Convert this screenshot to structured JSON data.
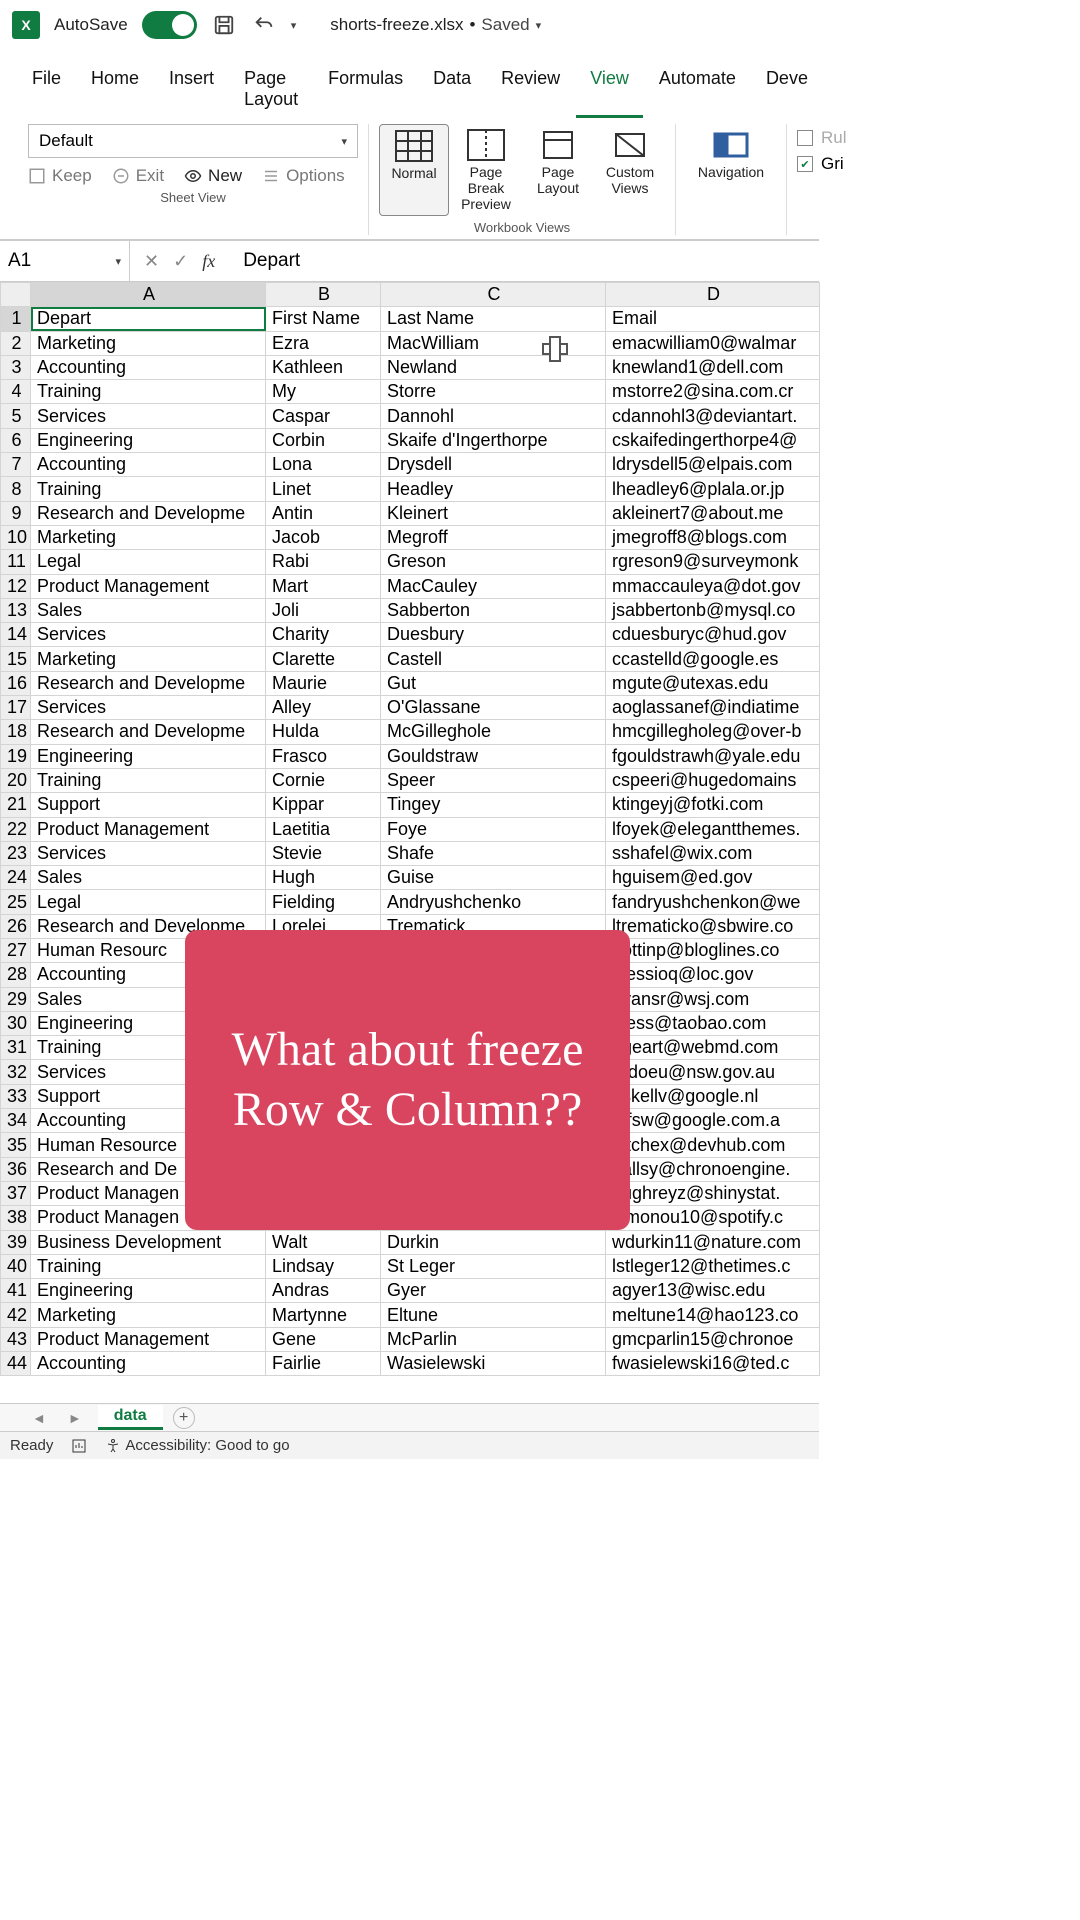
{
  "titlebar": {
    "autosave": "AutoSave",
    "filename": "shorts-freeze.xlsx",
    "state": "Saved"
  },
  "tabs": [
    "File",
    "Home",
    "Insert",
    "Page Layout",
    "Formulas",
    "Data",
    "Review",
    "View",
    "Automate",
    "Deve"
  ],
  "active_tab_index": 7,
  "ribbon": {
    "sheetview": {
      "selector": "Default",
      "keep": "Keep",
      "exit": "Exit",
      "new": "New",
      "options": "Options",
      "group_label": "Sheet View"
    },
    "views": {
      "normal": "Normal",
      "pagebreak": "Page Break Preview",
      "pagelayout": "Page Layout",
      "custom": "Custom Views",
      "group_label": "Workbook Views"
    },
    "nav": {
      "label": "Navigation"
    },
    "show": {
      "rulers": "Rul",
      "gridlines": "Gri"
    }
  },
  "formula_bar": {
    "name": "A1",
    "value": "Depart"
  },
  "columns": [
    "A",
    "B",
    "C",
    "D"
  ],
  "headers": {
    "A": "Depart",
    "B": "First Name",
    "C": "Last Name",
    "D": "Email"
  },
  "rows": [
    {
      "n": 2,
      "A": "Marketing",
      "B": "Ezra",
      "C": "MacWilliam",
      "D": "emacwilliam0@walmar"
    },
    {
      "n": 3,
      "A": "Accounting",
      "B": "Kathleen",
      "C": "Newland",
      "D": "knewland1@dell.com"
    },
    {
      "n": 4,
      "A": "Training",
      "B": "My",
      "C": "Storre",
      "D": "mstorre2@sina.com.cr"
    },
    {
      "n": 5,
      "A": "Services",
      "B": "Caspar",
      "C": "Dannohl",
      "D": "cdannohl3@deviantart."
    },
    {
      "n": 6,
      "A": "Engineering",
      "B": "Corbin",
      "C": "Skaife d'Ingerthorpe",
      "D": "cskaifedingerthorpe4@"
    },
    {
      "n": 7,
      "A": "Accounting",
      "B": "Lona",
      "C": "Drysdell",
      "D": "ldrysdell5@elpais.com"
    },
    {
      "n": 8,
      "A": "Training",
      "B": "Linet",
      "C": "Headley",
      "D": "lheadley6@plala.or.jp"
    },
    {
      "n": 9,
      "A": "Research and Developme",
      "B": "Antin",
      "C": "Kleinert",
      "D": "akleinert7@about.me"
    },
    {
      "n": 10,
      "A": "Marketing",
      "B": "Jacob",
      "C": "Megroff",
      "D": "jmegroff8@blogs.com"
    },
    {
      "n": 11,
      "A": "Legal",
      "B": "Rabi",
      "C": "Greson",
      "D": "rgreson9@surveymonk"
    },
    {
      "n": 12,
      "A": "Product Management",
      "B": "Mart",
      "C": "MacCauley",
      "D": "mmaccauleya@dot.gov"
    },
    {
      "n": 13,
      "A": "Sales",
      "B": "Joli",
      "C": "Sabberton",
      "D": "jsabbertonb@mysql.co"
    },
    {
      "n": 14,
      "A": "Services",
      "B": "Charity",
      "C": "Duesbury",
      "D": "cduesburyc@hud.gov"
    },
    {
      "n": 15,
      "A": "Marketing",
      "B": "Clarette",
      "C": "Castell",
      "D": "ccastelld@google.es"
    },
    {
      "n": 16,
      "A": "Research and Developme",
      "B": "Maurie",
      "C": "Gut",
      "D": "mgute@utexas.edu"
    },
    {
      "n": 17,
      "A": "Services",
      "B": "Alley",
      "C": "O'Glassane",
      "D": "aoglassanef@indiatime"
    },
    {
      "n": 18,
      "A": "Research and Developme",
      "B": "Hulda",
      "C": "McGilleghole",
      "D": "hmcgillegholeg@over-b"
    },
    {
      "n": 19,
      "A": "Engineering",
      "B": "Frasco",
      "C": "Gouldstraw",
      "D": "fgouldstrawh@yale.edu"
    },
    {
      "n": 20,
      "A": "Training",
      "B": "Cornie",
      "C": "Speer",
      "D": "cspeeri@hugedomains"
    },
    {
      "n": 21,
      "A": "Support",
      "B": "Kippar",
      "C": "Tingey",
      "D": "ktingeyj@fotki.com"
    },
    {
      "n": 22,
      "A": "Product Management",
      "B": "Laetitia",
      "C": "Foye",
      "D": "lfoyek@elegantthemes."
    },
    {
      "n": 23,
      "A": "Services",
      "B": "Stevie",
      "C": "Shafe",
      "D": "sshafel@wix.com"
    },
    {
      "n": 24,
      "A": "Sales",
      "B": "Hugh",
      "C": "Guise",
      "D": "hguisem@ed.gov"
    },
    {
      "n": 25,
      "A": "Legal",
      "B": "Fielding",
      "C": "Andryushchenko",
      "D": "fandryushchenkon@we"
    },
    {
      "n": 26,
      "A": "Research and Developme",
      "B": "Lorelei",
      "C": "Trematick",
      "D": "ltrematicko@sbwire.co"
    },
    {
      "n": 27,
      "A": "Human Resourc",
      "B": "",
      "C": "",
      "D": "hottinp@bloglines.co"
    },
    {
      "n": 28,
      "A": "Accounting",
      "B": "",
      "C": "",
      "D": "alessioq@loc.gov"
    },
    {
      "n": 29,
      "A": "Sales",
      "B": "",
      "C": "",
      "D": "oyansr@wsj.com"
    },
    {
      "n": 30,
      "A": "Engineering",
      "B": "",
      "C": "",
      "D": "ldess@taobao.com"
    },
    {
      "n": 31,
      "A": "Training",
      "B": "",
      "C": "",
      "D": "egeart@webmd.com"
    },
    {
      "n": 32,
      "A": "Services",
      "B": "",
      "C": "",
      "D": "ardoeu@nsw.gov.au"
    },
    {
      "n": 33,
      "A": "Support",
      "B": "",
      "C": "",
      "D": "askellv@google.nl"
    },
    {
      "n": 34,
      "A": "Accounting",
      "B": "",
      "C": "",
      "D": "effsw@google.com.a"
    },
    {
      "n": 35,
      "A": "Human Resource",
      "B": "",
      "C": "",
      "D": "eitchex@devhub.com"
    },
    {
      "n": 36,
      "A": "Research and De",
      "B": "",
      "C": "",
      "D": "ballsy@chronoengine."
    },
    {
      "n": 37,
      "A": "Product Managen",
      "B": "",
      "C": "",
      "D": "aughreyz@shinystat."
    },
    {
      "n": 38,
      "A": "Product Managen",
      "B": "",
      "C": "",
      "D": "simonou10@spotify.c"
    },
    {
      "n": 39,
      "A": "Business Development",
      "B": "Walt",
      "C": "Durkin",
      "D": "wdurkin11@nature.com"
    },
    {
      "n": 40,
      "A": "Training",
      "B": "Lindsay",
      "C": "St Leger",
      "D": "lstleger12@thetimes.c"
    },
    {
      "n": 41,
      "A": "Engineering",
      "B": "Andras",
      "C": "Gyer",
      "D": "agyer13@wisc.edu"
    },
    {
      "n": 42,
      "A": "Marketing",
      "B": "Martynne",
      "C": "Eltune",
      "D": "meltune14@hao123.co"
    },
    {
      "n": 43,
      "A": "Product Management",
      "B": "Gene",
      "C": "McParlin",
      "D": "gmcparlin15@chronoe"
    },
    {
      "n": 44,
      "A": "Accounting",
      "B": "Fairlie",
      "C": "Wasielewski",
      "D": "fwasielewski16@ted.c"
    }
  ],
  "overlay": "What about freeze Row & Column??",
  "sheet_tab": "data",
  "status": {
    "ready": "Ready",
    "accessibility": "Accessibility: Good to go"
  }
}
